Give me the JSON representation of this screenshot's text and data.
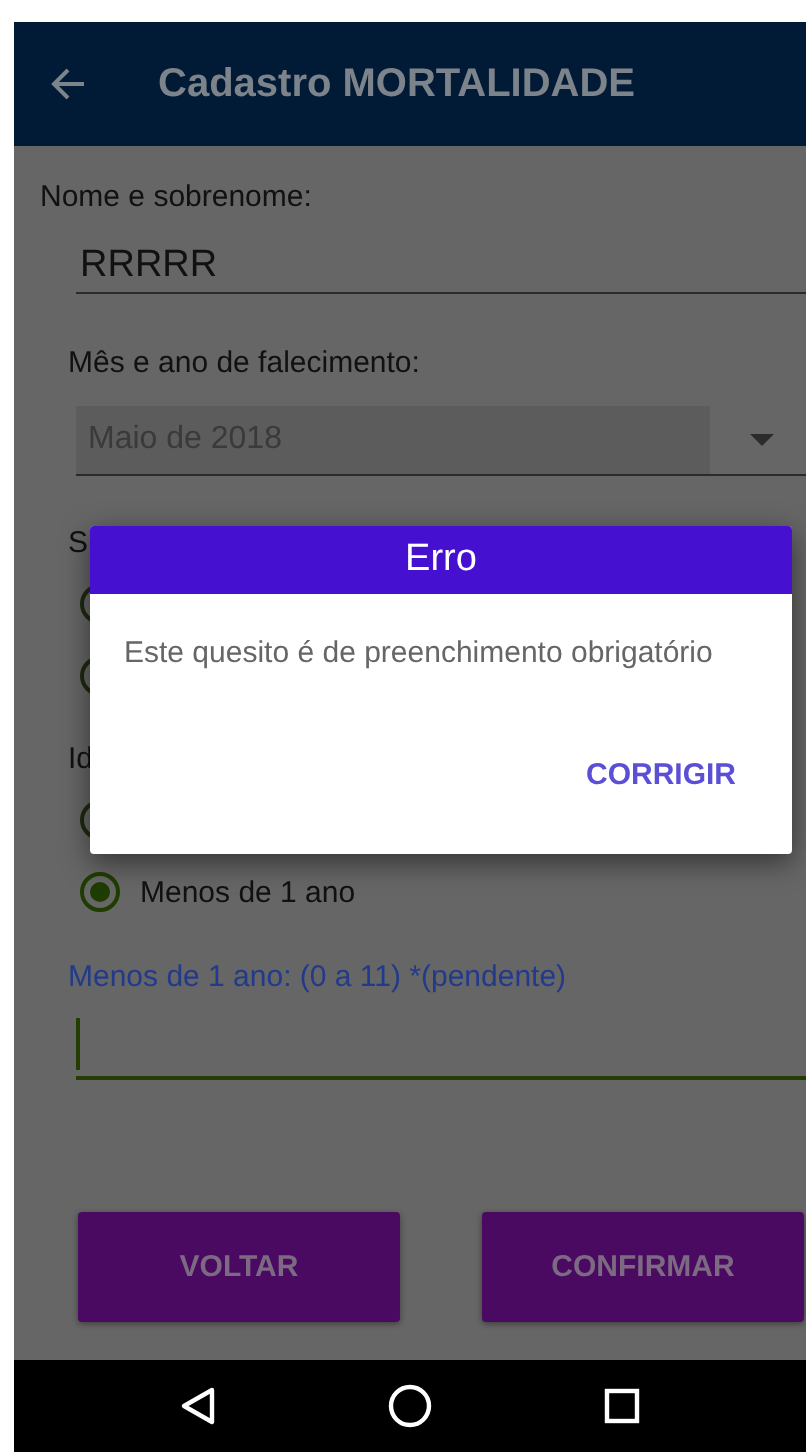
{
  "app_bar": {
    "title": "Cadastro MORTALIDADE"
  },
  "form": {
    "name_field": {
      "label": "Nome e sobrenome:",
      "value": "RRRRR"
    },
    "death_date": {
      "label": "Mês e ano de falecimento:",
      "value": "Maio de 2018",
      "disabled": true
    },
    "sex": {
      "label": "S",
      "options": [
        {
          "selected": false
        },
        {
          "selected": false
        }
      ]
    },
    "age": {
      "label": "Id",
      "options": [
        {
          "selected": false
        },
        {
          "label": "Menos de 1 ano",
          "selected": true
        }
      ]
    },
    "months_field": {
      "label": "Menos de 1 ano: (0 a 11) *(pendente)",
      "focused": true
    }
  },
  "buttons": [
    {
      "label": "VOLTAR"
    },
    {
      "label": "CONFIRMAR"
    }
  ],
  "dialog": {
    "title": "Erro",
    "message": "Este quesito é de preenchimento obrigatório",
    "action": "CORRIGIR"
  }
}
